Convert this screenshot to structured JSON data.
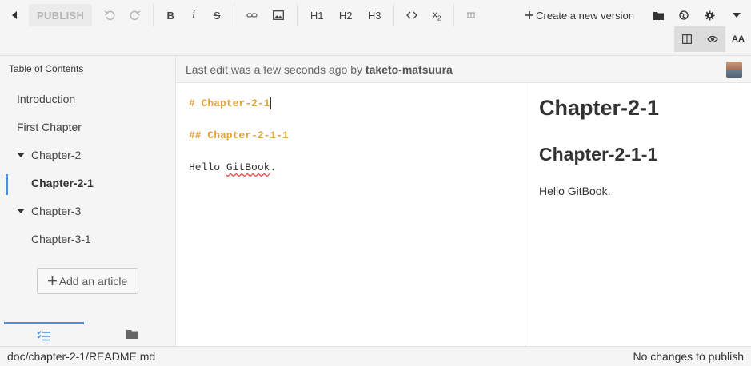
{
  "toolbar": {
    "publish_label": "PUBLISH",
    "h1_label": "H1",
    "h2_label": "H2",
    "h3_label": "H3",
    "new_version_label": "Create a new version",
    "font_size_label": "AA"
  },
  "sidebar": {
    "title": "Table of Contents",
    "items": [
      {
        "label": "Introduction"
      },
      {
        "label": "First Chapter"
      },
      {
        "label": "Chapter-2"
      },
      {
        "label": "Chapter-2-1"
      },
      {
        "label": "Chapter-3"
      },
      {
        "label": "Chapter-3-1"
      }
    ],
    "add_article_label": "Add an article"
  },
  "info_bar": {
    "text": "Last edit was a few seconds ago by ",
    "user": "taketo-matsuura"
  },
  "editor": {
    "line1": "# Chapter-2-1",
    "line2": "## Chapter-2-1-1",
    "line3_prefix": "Hello ",
    "line3_word": "GitBook",
    "line3_suffix": "."
  },
  "preview": {
    "h1": "Chapter-2-1",
    "h2": "Chapter-2-1-1",
    "paragraph": "Hello GitBook."
  },
  "status_bar": {
    "file_path": "doc/chapter-2-1/README.md",
    "publish_status": "No changes to publish"
  },
  "colors": {
    "accent": "#4a90e2",
    "heading_markdown": "#e0a33a"
  }
}
